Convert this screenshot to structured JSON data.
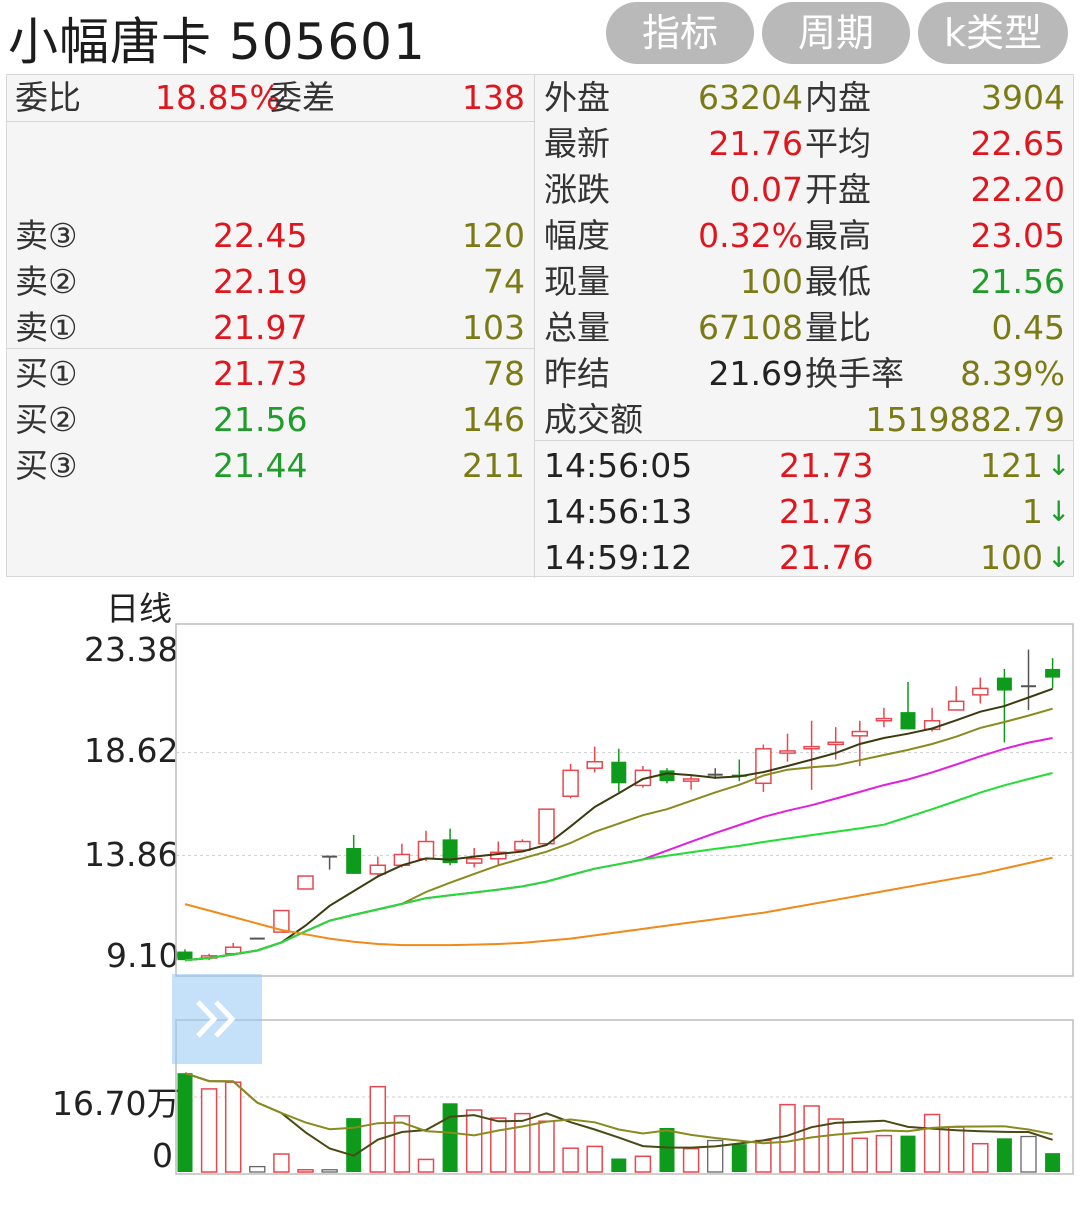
{
  "header": {
    "title": "小幅唐卡 505601",
    "buttons": [
      "指标",
      "周期",
      "k类型"
    ]
  },
  "order_book": {
    "weibi_label": "委比",
    "weibi_value": "18.85%",
    "weicha_label": "委差",
    "weicha_value": "138",
    "asks": [
      {
        "label": "卖③",
        "price": "22.45",
        "volume": "120"
      },
      {
        "label": "卖②",
        "price": "22.19",
        "volume": "74"
      },
      {
        "label": "卖①",
        "price": "21.97",
        "volume": "103"
      }
    ],
    "bids": [
      {
        "label": "买①",
        "price": "21.73",
        "volume": "78"
      },
      {
        "label": "买②",
        "price": "21.56",
        "volume": "146"
      },
      {
        "label": "买③",
        "price": "21.44",
        "volume": "211"
      }
    ]
  },
  "quote": {
    "rows": [
      {
        "l1": "外盘",
        "v1": "63204",
        "l2": "内盘",
        "v2": "3904"
      },
      {
        "l1": "最新",
        "v1": "21.76",
        "l2": "平均",
        "v2": "22.65"
      },
      {
        "l1": "涨跌",
        "v1": "0.07",
        "l2": "开盘",
        "v2": "22.20"
      },
      {
        "l1": "幅度",
        "v1": "0.32%",
        "l2": "最高",
        "v2": "23.05"
      },
      {
        "l1": "现量",
        "v1": "100",
        "l2": "最低",
        "v2": "21.56"
      },
      {
        "l1": "总量",
        "v1": "67108",
        "l2": "量比",
        "v2": "0.45"
      },
      {
        "l1": "昨结",
        "v1": "21.69",
        "l2": "换手率",
        "v2": "8.39%"
      }
    ],
    "turnover_label": "成交额",
    "turnover_value": "1519882.79"
  },
  "ticks": [
    {
      "time": "14:56:05",
      "price": "21.73",
      "volume": "121",
      "dir": "↓"
    },
    {
      "time": "14:56:13",
      "price": "21.73",
      "volume": "1",
      "dir": "↓"
    },
    {
      "time": "14:59:12",
      "price": "21.76",
      "volume": "100",
      "dir": "↓"
    }
  ],
  "chart": {
    "period_label": "日线",
    "price_ticks": [
      "23.38",
      "18.62",
      "13.86",
      "9.10"
    ],
    "volume_ticks": [
      "16.70万",
      "0"
    ]
  },
  "colors": {
    "up": "#e8474f",
    "down": "#0e9a1a",
    "accent": "#b9b9b9"
  },
  "chart_data": {
    "type": "candlestick",
    "price_range": [
      9.1,
      23.38
    ],
    "volume_ticks_values": [
      167000,
      0
    ],
    "candles": [
      {
        "o": 9.4,
        "c": 9.0,
        "h": 9.5,
        "l": 9.0,
        "v": 220000
      },
      {
        "o": 9.1,
        "c": 9.2,
        "h": 9.3,
        "l": 9.0,
        "v": 185000
      },
      {
        "o": 9.3,
        "c": 9.6,
        "h": 9.8,
        "l": 9.2,
        "v": 200000
      },
      {
        "o": 10.0,
        "c": 10.0,
        "h": 10.0,
        "l": 10.0,
        "v": 12000
      },
      {
        "o": 10.3,
        "c": 11.3,
        "h": 11.3,
        "l": 10.3,
        "v": 40000
      },
      {
        "o": 12.3,
        "c": 12.9,
        "h": 12.9,
        "l": 12.3,
        "v": 5000
      },
      {
        "o": 13.8,
        "c": 13.8,
        "h": 13.8,
        "l": 13.2,
        "v": 5000
      },
      {
        "o": 14.2,
        "c": 13.0,
        "h": 14.8,
        "l": 13.0,
        "v": 120000
      },
      {
        "o": 13.0,
        "c": 13.4,
        "h": 13.8,
        "l": 12.9,
        "v": 190000
      },
      {
        "o": 13.4,
        "c": 13.9,
        "h": 14.4,
        "l": 13.3,
        "v": 125000
      },
      {
        "o": 13.7,
        "c": 14.5,
        "h": 15.0,
        "l": 13.6,
        "v": 28000
      },
      {
        "o": 14.6,
        "c": 13.5,
        "h": 15.1,
        "l": 13.4,
        "v": 153000
      },
      {
        "o": 13.5,
        "c": 13.7,
        "h": 14.2,
        "l": 13.3,
        "v": 138000
      },
      {
        "o": 13.7,
        "c": 14.0,
        "h": 14.5,
        "l": 13.4,
        "v": 120000
      },
      {
        "o": 14.1,
        "c": 14.5,
        "h": 14.6,
        "l": 14.0,
        "v": 130000
      },
      {
        "o": 14.4,
        "c": 16.0,
        "h": 16.0,
        "l": 14.3,
        "v": 113000
      },
      {
        "o": 16.6,
        "c": 17.8,
        "h": 18.1,
        "l": 16.5,
        "v": 53000
      },
      {
        "o": 17.9,
        "c": 18.2,
        "h": 18.9,
        "l": 17.7,
        "v": 57000
      },
      {
        "o": 18.2,
        "c": 17.2,
        "h": 18.8,
        "l": 16.8,
        "v": 30000
      },
      {
        "o": 17.1,
        "c": 17.8,
        "h": 18.0,
        "l": 17.0,
        "v": 35000
      },
      {
        "o": 17.8,
        "c": 17.3,
        "h": 17.9,
        "l": 17.2,
        "v": 98000
      },
      {
        "o": 17.3,
        "c": 17.4,
        "h": 17.6,
        "l": 16.9,
        "v": 52000
      },
      {
        "o": 17.6,
        "c": 17.6,
        "h": 17.9,
        "l": 17.4,
        "v": 70000
      },
      {
        "o": 17.6,
        "c": 17.5,
        "h": 18.3,
        "l": 17.3,
        "v": 62000
      },
      {
        "o": 17.2,
        "c": 18.8,
        "h": 19.0,
        "l": 16.8,
        "v": 70000
      },
      {
        "o": 18.6,
        "c": 18.7,
        "h": 19.5,
        "l": 18.2,
        "v": 150000
      },
      {
        "o": 18.8,
        "c": 18.9,
        "h": 20.1,
        "l": 16.9,
        "v": 147000
      },
      {
        "o": 19.0,
        "c": 19.1,
        "h": 19.8,
        "l": 18.3,
        "v": 118000
      },
      {
        "o": 19.4,
        "c": 19.6,
        "h": 20.1,
        "l": 18.0,
        "v": 75000
      },
      {
        "o": 20.1,
        "c": 20.2,
        "h": 20.7,
        "l": 19.8,
        "v": 81000
      },
      {
        "o": 20.5,
        "c": 19.7,
        "h": 21.9,
        "l": 19.7,
        "v": 81000
      },
      {
        "o": 19.7,
        "c": 20.1,
        "h": 20.7,
        "l": 19.6,
        "v": 128000
      },
      {
        "o": 20.6,
        "c": 21.0,
        "h": 21.7,
        "l": 20.6,
        "v": 100000
      },
      {
        "o": 21.3,
        "c": 21.6,
        "h": 22.1,
        "l": 20.9,
        "v": 63000
      },
      {
        "o": 22.1,
        "c": 21.5,
        "h": 22.5,
        "l": 19.1,
        "v": 75000
      },
      {
        "o": 21.7,
        "c": 21.7,
        "h": 23.4,
        "l": 20.6,
        "v": 79000
      },
      {
        "o": 22.5,
        "c": 22.1,
        "h": 23.0,
        "l": 21.6,
        "v": 42000
      }
    ]
  }
}
